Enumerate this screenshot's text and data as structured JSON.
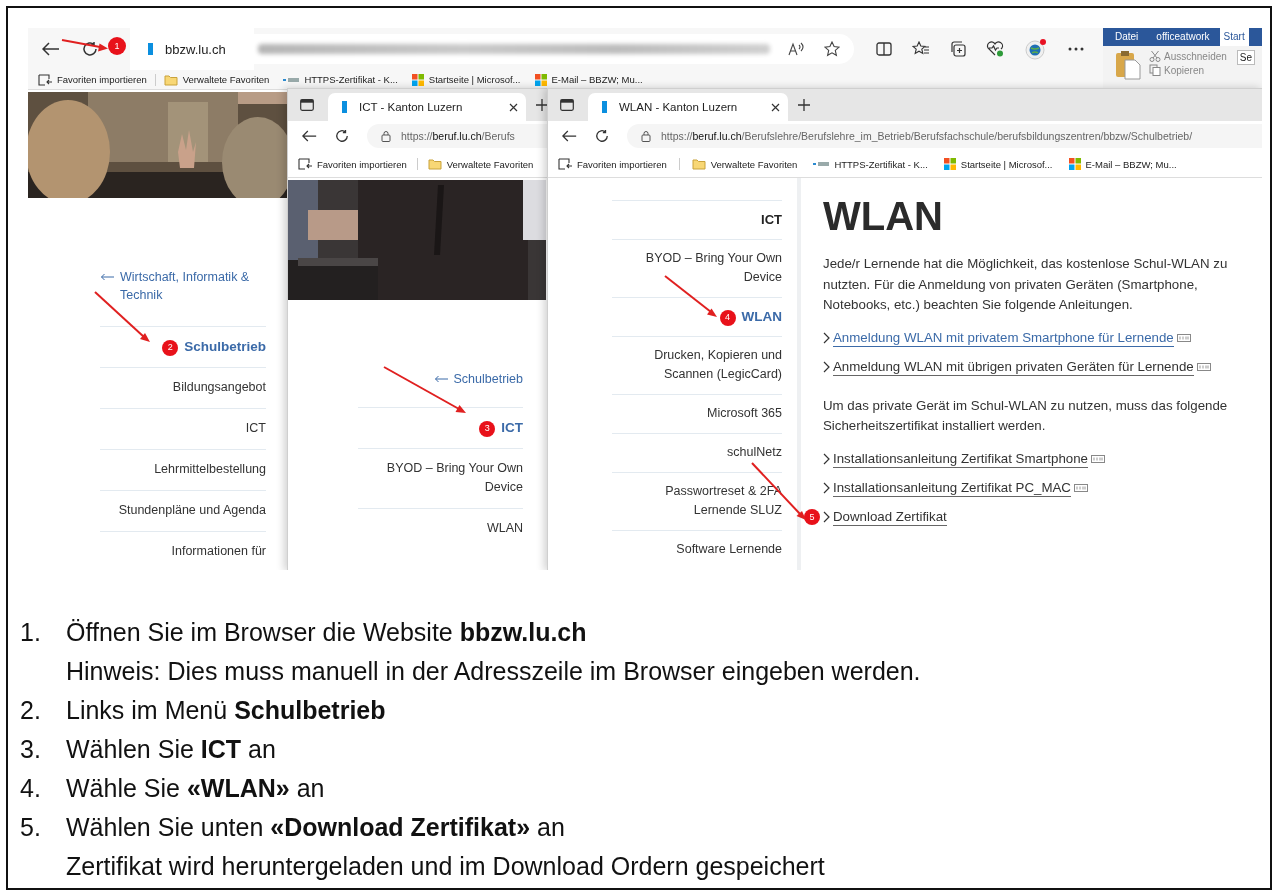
{
  "base_window": {
    "step": "1",
    "tab": "bbzw.lu.ch",
    "bookmarks": [
      {
        "kind": "import",
        "label": "Favoriten importieren"
      },
      {
        "kind": "folder",
        "label": "Verwaltete Favoriten"
      },
      {
        "kind": "key",
        "label": "HTTPS-Zertifikat - K..."
      },
      {
        "kind": "windows",
        "label": "Startseite | Microsof..."
      },
      {
        "kind": "windows",
        "label": "E-Mail – BBZW; Mu..."
      }
    ],
    "ribbon": {
      "tabs": [
        {
          "label": "Datei",
          "selected": false
        },
        {
          "label": "officeatwork",
          "selected": false
        },
        {
          "label": "Start",
          "selected": true
        }
      ],
      "commands": [
        {
          "kind": "cut",
          "label": "Ausschneiden"
        },
        {
          "kind": "copy",
          "label": "Kopieren"
        }
      ],
      "field": "Se"
    },
    "back_link": "Wirtschaft, Informatik & Technik",
    "nav": [
      {
        "label": "Schulbetrieb",
        "selected": true,
        "step": "2"
      },
      {
        "label": "Bildungsangebot",
        "selected": false
      },
      {
        "label": "ICT",
        "selected": false
      },
      {
        "label": "Lehrmittelbestellung",
        "selected": false
      },
      {
        "label": "Stundenpläne und Agenda",
        "selected": false
      },
      {
        "label": "Informationen für",
        "selected": false
      }
    ]
  },
  "ict_window": {
    "tab": "ICT - Kanton Luzern",
    "address": {
      "scheme": "https://",
      "host": "beruf.lu.ch",
      "path": "/Berufs"
    },
    "bookmarks": [
      {
        "kind": "import",
        "label": "Favoriten importieren"
      },
      {
        "kind": "folder",
        "label": "Verwaltete Favoriten"
      }
    ],
    "back_link": "Schulbetrieb",
    "nav": [
      {
        "label": "ICT",
        "selected": true,
        "step": "3"
      },
      {
        "label": "BYOD – Bring Your Own Device",
        "selected": false
      },
      {
        "label": "WLAN",
        "selected": false
      }
    ]
  },
  "wlan_window": {
    "tab": "WLAN - Kanton Luzern",
    "address": {
      "scheme": "https://",
      "host": "beruf.lu.ch",
      "path": "/Berufslehre/Berufslehre_im_Betrieb/Berufsfachschule/berufsbildungszentren/bbzw/Schulbetrieb/"
    },
    "bookmarks": [
      {
        "kind": "import",
        "label": "Favoriten importieren"
      },
      {
        "kind": "folder",
        "label": "Verwaltete Favoriten"
      },
      {
        "kind": "key",
        "label": "HTTPS-Zertifikat - K..."
      },
      {
        "kind": "windows",
        "label": "Startseite | Microsof..."
      },
      {
        "kind": "windows",
        "label": "E-Mail – BBZW; Mu..."
      }
    ],
    "nav_parent": "ICT",
    "nav": [
      {
        "label": "BYOD – Bring Your Own Device",
        "selected": false
      },
      {
        "label": "WLAN",
        "selected": true,
        "step": "4"
      },
      {
        "label": "Drucken, Kopieren und Scannen (LegicCard)",
        "selected": false
      },
      {
        "label": "Microsoft 365",
        "selected": false
      },
      {
        "label": "schulNetz",
        "selected": false
      },
      {
        "label": "Passwortreset & 2FA Lernende SLUZ",
        "selected": false
      },
      {
        "label": "Software Lernende",
        "selected": false
      }
    ],
    "title": "WLAN",
    "sections": [
      {
        "text": "Jede/r Lernende hat die Möglichkeit, das kostenlose Schul-WLAN zu nutzten. Für die Anmeldung von privaten Geräten (Smartphone, Notebooks, etc.) beachten Sie folgende Anleitungen.",
        "links": [
          {
            "label": "Anmeldung WLAN mit privatem Smartphone für Lernende",
            "highlighted": true,
            "pdf": true
          },
          {
            "label": "Anmeldung WLAN mit übrigen privaten Geräten für Lernende",
            "highlighted": false,
            "pdf": true
          }
        ]
      },
      {
        "text": "Um das private Gerät im Schul-WLAN zu nutzen, muss das folgende Sicherheitszertifikat installiert werden.",
        "links": [
          {
            "label": "Installationsanleitung Zertifikat Smartphone",
            "highlighted": false,
            "pdf": true
          },
          {
            "label": "Installationsanleitung Zertifikat PC_MAC",
            "highlighted": false,
            "pdf": true
          },
          {
            "label": "Download Zertifikat",
            "highlighted": false,
            "pdf": false,
            "step": "5"
          }
        ]
      }
    ]
  },
  "instructions": [
    {
      "number": "1.",
      "text": "Öffnen Sie im Browser die Website **bbzw.lu.ch**",
      "note": "Hinweis: Dies muss manuell in der Adresszeile im Browser eingeben werden."
    },
    {
      "number": "2.",
      "text": "Links im Menü **Schulbetrieb**"
    },
    {
      "number": "3.",
      "text": "Wählen Sie **ICT** an"
    },
    {
      "number": "4.",
      "text": "Wähle Sie **«WLAN»** an"
    },
    {
      "number": "5.",
      "text": "Wählen Sie unten **«Download Zertifikat»** an",
      "note": "Zertifikat wird heruntergeladen und im Download Ordern gespeichert"
    }
  ]
}
